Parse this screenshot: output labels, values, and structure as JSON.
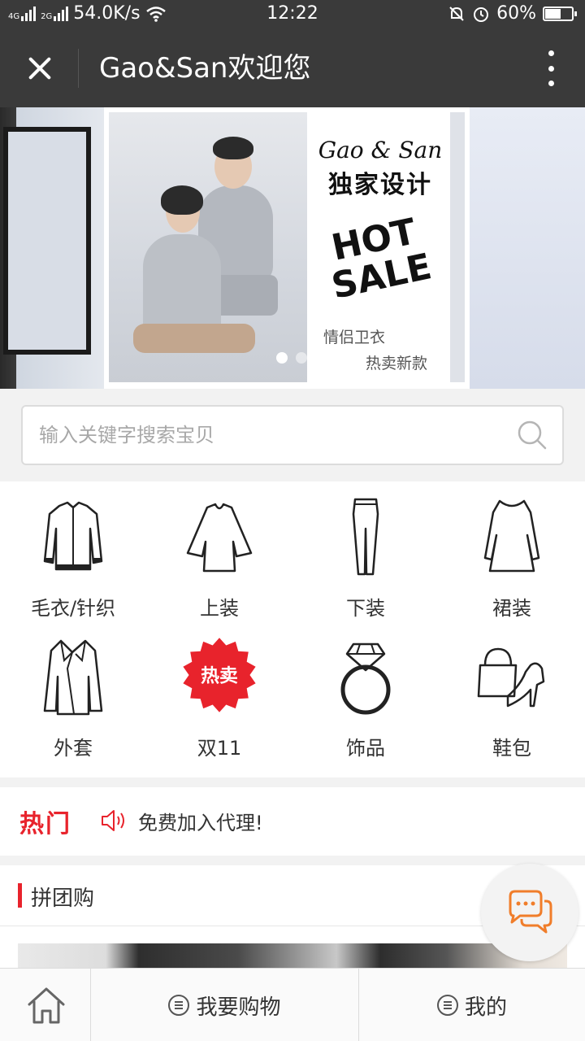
{
  "status_bar": {
    "network_1": "4G",
    "network_2": "2G",
    "speed": "54.0K/s",
    "time": "12:22",
    "battery": "60%",
    "battery_level": 0.6
  },
  "title_bar": {
    "title": "Gao&San欢迎您"
  },
  "banner": {
    "brand": "Gao & San",
    "brand_sub": "独家设计",
    "hot_line1": "HOT",
    "hot_line2": "SALE",
    "text1": "情侣卫衣",
    "text2": "热卖新款",
    "active_dot": 1,
    "dot_count": 2
  },
  "search": {
    "placeholder": "输入关键字搜索宝贝"
  },
  "categories": [
    {
      "label": "毛衣/针织",
      "icon": "cardigan-icon"
    },
    {
      "label": "上装",
      "icon": "top-icon"
    },
    {
      "label": "下装",
      "icon": "pants-icon"
    },
    {
      "label": "裙装",
      "icon": "dress-icon"
    },
    {
      "label": "外套",
      "icon": "coat-icon"
    },
    {
      "label": "双11",
      "icon": "hot-sale-badge-icon",
      "badge_text": "热卖"
    },
    {
      "label": "饰品",
      "icon": "ring-icon"
    },
    {
      "label": "鞋包",
      "icon": "bag-shoe-icon"
    }
  ],
  "notice": {
    "tag": "热门",
    "text": "免费加入代理!"
  },
  "group_buy": {
    "title": "拼团购"
  },
  "bottom_nav": {
    "shop_label": "我要购物",
    "mine_label": "我的"
  },
  "colors": {
    "accent_red": "#e8232c",
    "header_bg": "#3a3a3a",
    "chat_orange": "#f07d2a"
  }
}
